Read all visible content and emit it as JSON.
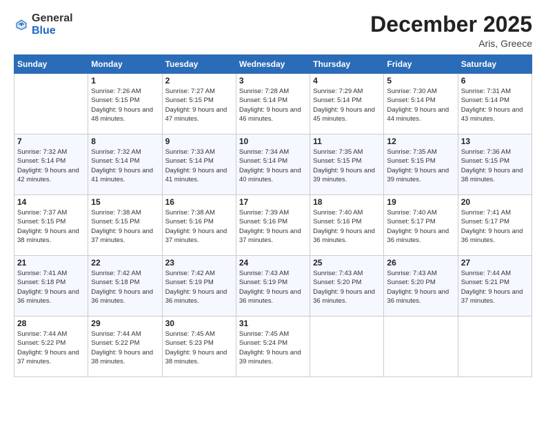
{
  "header": {
    "logo_general": "General",
    "logo_blue": "Blue",
    "month_title": "December 2025",
    "location": "Aris, Greece"
  },
  "days_of_week": [
    "Sunday",
    "Monday",
    "Tuesday",
    "Wednesday",
    "Thursday",
    "Friday",
    "Saturday"
  ],
  "weeks": [
    [
      {
        "day": "",
        "sunrise": "",
        "sunset": "",
        "daylight": ""
      },
      {
        "day": "1",
        "sunrise": "7:26 AM",
        "sunset": "5:15 PM",
        "daylight": "9 hours and 48 minutes."
      },
      {
        "day": "2",
        "sunrise": "7:27 AM",
        "sunset": "5:15 PM",
        "daylight": "9 hours and 47 minutes."
      },
      {
        "day": "3",
        "sunrise": "7:28 AM",
        "sunset": "5:14 PM",
        "daylight": "9 hours and 46 minutes."
      },
      {
        "day": "4",
        "sunrise": "7:29 AM",
        "sunset": "5:14 PM",
        "daylight": "9 hours and 45 minutes."
      },
      {
        "day": "5",
        "sunrise": "7:30 AM",
        "sunset": "5:14 PM",
        "daylight": "9 hours and 44 minutes."
      },
      {
        "day": "6",
        "sunrise": "7:31 AM",
        "sunset": "5:14 PM",
        "daylight": "9 hours and 43 minutes."
      }
    ],
    [
      {
        "day": "7",
        "sunrise": "7:32 AM",
        "sunset": "5:14 PM",
        "daylight": "9 hours and 42 minutes."
      },
      {
        "day": "8",
        "sunrise": "7:32 AM",
        "sunset": "5:14 PM",
        "daylight": "9 hours and 41 minutes."
      },
      {
        "day": "9",
        "sunrise": "7:33 AM",
        "sunset": "5:14 PM",
        "daylight": "9 hours and 41 minutes."
      },
      {
        "day": "10",
        "sunrise": "7:34 AM",
        "sunset": "5:14 PM",
        "daylight": "9 hours and 40 minutes."
      },
      {
        "day": "11",
        "sunrise": "7:35 AM",
        "sunset": "5:15 PM",
        "daylight": "9 hours and 39 minutes."
      },
      {
        "day": "12",
        "sunrise": "7:35 AM",
        "sunset": "5:15 PM",
        "daylight": "9 hours and 39 minutes."
      },
      {
        "day": "13",
        "sunrise": "7:36 AM",
        "sunset": "5:15 PM",
        "daylight": "9 hours and 38 minutes."
      }
    ],
    [
      {
        "day": "14",
        "sunrise": "7:37 AM",
        "sunset": "5:15 PM",
        "daylight": "9 hours and 38 minutes."
      },
      {
        "day": "15",
        "sunrise": "7:38 AM",
        "sunset": "5:15 PM",
        "daylight": "9 hours and 37 minutes."
      },
      {
        "day": "16",
        "sunrise": "7:38 AM",
        "sunset": "5:16 PM",
        "daylight": "9 hours and 37 minutes."
      },
      {
        "day": "17",
        "sunrise": "7:39 AM",
        "sunset": "5:16 PM",
        "daylight": "9 hours and 37 minutes."
      },
      {
        "day": "18",
        "sunrise": "7:40 AM",
        "sunset": "5:16 PM",
        "daylight": "9 hours and 36 minutes."
      },
      {
        "day": "19",
        "sunrise": "7:40 AM",
        "sunset": "5:17 PM",
        "daylight": "9 hours and 36 minutes."
      },
      {
        "day": "20",
        "sunrise": "7:41 AM",
        "sunset": "5:17 PM",
        "daylight": "9 hours and 36 minutes."
      }
    ],
    [
      {
        "day": "21",
        "sunrise": "7:41 AM",
        "sunset": "5:18 PM",
        "daylight": "9 hours and 36 minutes."
      },
      {
        "day": "22",
        "sunrise": "7:42 AM",
        "sunset": "5:18 PM",
        "daylight": "9 hours and 36 minutes."
      },
      {
        "day": "23",
        "sunrise": "7:42 AM",
        "sunset": "5:19 PM",
        "daylight": "9 hours and 36 minutes."
      },
      {
        "day": "24",
        "sunrise": "7:43 AM",
        "sunset": "5:19 PM",
        "daylight": "9 hours and 36 minutes."
      },
      {
        "day": "25",
        "sunrise": "7:43 AM",
        "sunset": "5:20 PM",
        "daylight": "9 hours and 36 minutes."
      },
      {
        "day": "26",
        "sunrise": "7:43 AM",
        "sunset": "5:20 PM",
        "daylight": "9 hours and 36 minutes."
      },
      {
        "day": "27",
        "sunrise": "7:44 AM",
        "sunset": "5:21 PM",
        "daylight": "9 hours and 37 minutes."
      }
    ],
    [
      {
        "day": "28",
        "sunrise": "7:44 AM",
        "sunset": "5:22 PM",
        "daylight": "9 hours and 37 minutes."
      },
      {
        "day": "29",
        "sunrise": "7:44 AM",
        "sunset": "5:22 PM",
        "daylight": "9 hours and 38 minutes."
      },
      {
        "day": "30",
        "sunrise": "7:45 AM",
        "sunset": "5:23 PM",
        "daylight": "9 hours and 38 minutes."
      },
      {
        "day": "31",
        "sunrise": "7:45 AM",
        "sunset": "5:24 PM",
        "daylight": "9 hours and 39 minutes."
      },
      {
        "day": "",
        "sunrise": "",
        "sunset": "",
        "daylight": ""
      },
      {
        "day": "",
        "sunrise": "",
        "sunset": "",
        "daylight": ""
      },
      {
        "day": "",
        "sunrise": "",
        "sunset": "",
        "daylight": ""
      }
    ]
  ],
  "labels": {
    "sunrise": "Sunrise:",
    "sunset": "Sunset:",
    "daylight": "Daylight:"
  }
}
